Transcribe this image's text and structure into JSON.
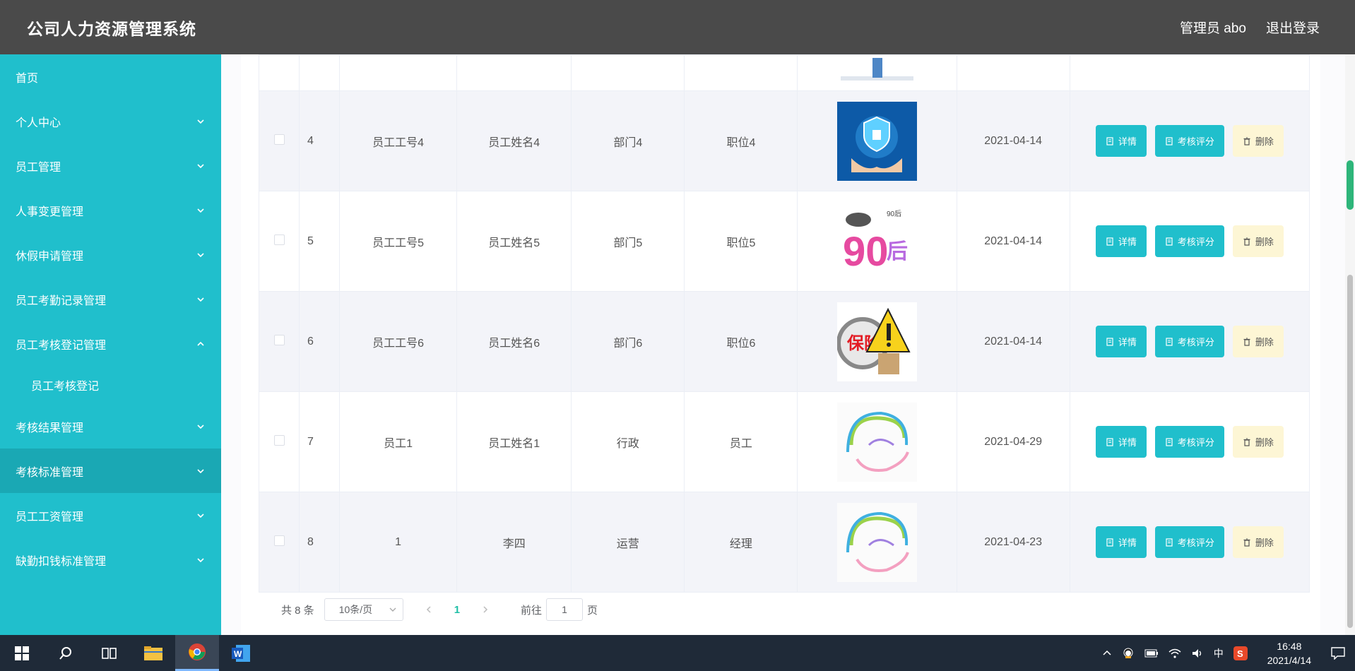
{
  "app": {
    "title": "公司人力资源管理系统",
    "user": "管理员 abo",
    "logout": "退出登录"
  },
  "sidebar": {
    "items": [
      {
        "label": "首页",
        "chevron": ""
      },
      {
        "label": "个人中心",
        "chevron": "down"
      },
      {
        "label": "员工管理",
        "chevron": "down"
      },
      {
        "label": "人事变更管理",
        "chevron": "down"
      },
      {
        "label": "休假申请管理",
        "chevron": "down"
      },
      {
        "label": "员工考勤记录管理",
        "chevron": "down"
      },
      {
        "label": "员工考核登记管理",
        "chevron": "up"
      },
      {
        "label": "员工考核登记",
        "chevron": "",
        "sub": true
      },
      {
        "label": "考核结果管理",
        "chevron": "down"
      },
      {
        "label": "考核标准管理",
        "chevron": "down",
        "active": true
      },
      {
        "label": "员工工资管理",
        "chevron": "down"
      },
      {
        "label": "缺勤扣钱标准管理",
        "chevron": "down"
      }
    ]
  },
  "table": {
    "rows": [
      {
        "num": "4",
        "id": "员工工号4",
        "name": "员工姓名4",
        "dept": "部门4",
        "pos": "职位4",
        "img": "shield-hands-icon",
        "date": "2021-04-14"
      },
      {
        "num": "5",
        "id": "员工工号5",
        "name": "员工姓名5",
        "dept": "部门5",
        "pos": "职位5",
        "img": "90s-poster-icon",
        "date": "2021-04-14"
      },
      {
        "num": "6",
        "id": "员工工号6",
        "name": "员工姓名6",
        "dept": "部门6",
        "pos": "职位6",
        "img": "insurance-warning-icon",
        "date": "2021-04-14"
      },
      {
        "num": "7",
        "id": "员工1",
        "name": "员工姓名1",
        "dept": "行政",
        "pos": "员工",
        "img": "swirl-art-icon",
        "date": "2021-04-29"
      },
      {
        "num": "8",
        "id": "1",
        "name": "李四",
        "dept": "运营",
        "pos": "经理",
        "img": "swirl-art-icon",
        "date": "2021-04-23"
      }
    ],
    "actions": {
      "detail": "详情",
      "review": "考核评分",
      "delete": "删除"
    }
  },
  "pagination": {
    "total": "共 8 条",
    "page_size": "10条/页",
    "current": "1",
    "goto_label": "前往",
    "goto_value": "1",
    "page_label": "页"
  },
  "taskbar": {
    "time": "16:48",
    "date": "2021/4/14",
    "ime": "中"
  },
  "colors": {
    "accent": "#20bfcc",
    "header": "#4a4a4a",
    "delete_bg": "#fdf6d5"
  }
}
